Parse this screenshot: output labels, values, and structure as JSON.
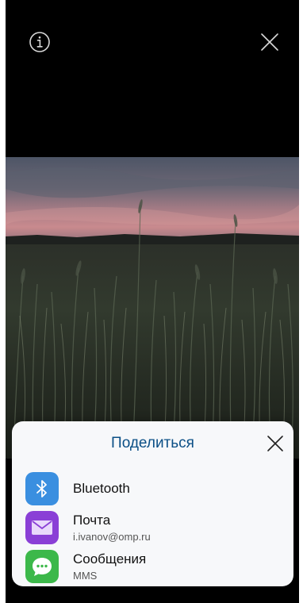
{
  "top_bar": {
    "info_icon": "info-circle-icon",
    "close_icon": "close-icon"
  },
  "photo": {
    "description_icon": "image"
  },
  "share_sheet": {
    "title": "Поделиться",
    "close_icon": "close-icon",
    "items": [
      {
        "label": "Bluetooth",
        "sublabel": "",
        "icon": "bluetooth-icon",
        "color": "#3a8fe0"
      },
      {
        "label": "Почта",
        "sublabel": "i.ivanov@omp.ru",
        "icon": "mail-icon",
        "color": "#8a3fd6"
      },
      {
        "label": "Сообщения",
        "sublabel": "MMS",
        "icon": "message-icon",
        "color": "#3cb84a"
      }
    ]
  },
  "colors": {
    "accent": "#0b4f86",
    "background": "#000000",
    "sheet": "#f7f8fa"
  }
}
